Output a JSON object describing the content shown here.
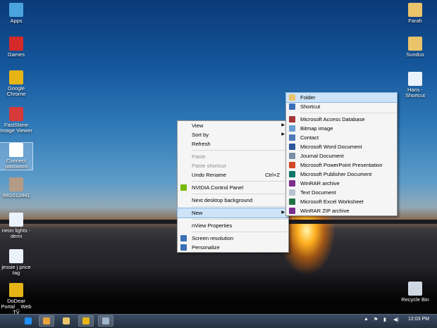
{
  "desktop_icons": [
    {
      "label": "Apps",
      "icon": "monitor-icon",
      "color": "#4aa3df"
    },
    {
      "label": "Games",
      "icon": "games-icon",
      "color": "#d42a2a"
    },
    {
      "label": "Google Chrome",
      "icon": "chrome-icon",
      "color": "#e7b416"
    },
    {
      "label": "FastStone Image Viewer",
      "icon": "faststone-icon",
      "color": "#d73a3a"
    },
    {
      "label": "Connect password",
      "icon": "document-icon",
      "color": "#ffffff"
    },
    {
      "label": "IMG013441",
      "icon": "image-icon",
      "color": "#b49b86"
    },
    {
      "label": "neon lights - demi",
      "icon": "audio-file-icon",
      "color": "#eaf2fb"
    },
    {
      "label": "jessie j price tag",
      "icon": "audio-file-icon",
      "color": "#eaf2fb"
    },
    {
      "label": "DoDear Portal _ Web TV",
      "icon": "chrome-icon",
      "color": "#e7b416"
    }
  ],
  "desktop_icons_right": [
    {
      "label": "Farah",
      "icon": "folder-icon",
      "color": "#e9c46a"
    },
    {
      "label": "Sundus",
      "icon": "folder-icon",
      "color": "#e9c46a"
    },
    {
      "label": "Hans - Shortcut",
      "icon": "shortcut-icon",
      "color": "#eaf2fb"
    },
    {
      "label": "Recycle Bin",
      "icon": "recycle-bin-icon",
      "color": "#cfd8e2"
    }
  ],
  "context_menu": [
    {
      "label": "View",
      "submenu": true
    },
    {
      "label": "Sort by",
      "submenu": true
    },
    {
      "label": "Refresh"
    },
    {
      "sep": true
    },
    {
      "label": "Paste",
      "disabled": true
    },
    {
      "label": "Paste shortcut",
      "disabled": true
    },
    {
      "label": "Undo Rename",
      "shortcut": "Ctrl+Z"
    },
    {
      "sep": true
    },
    {
      "label": "NVIDIA Control Panel",
      "icon": "nvidia-icon",
      "color": "#76b900"
    },
    {
      "sep": true
    },
    {
      "label": "Next desktop background"
    },
    {
      "sep": true
    },
    {
      "label": "New",
      "submenu": true,
      "highlighted": true
    },
    {
      "sep": true
    },
    {
      "label": "nView Properties"
    },
    {
      "sep": true
    },
    {
      "label": "Screen resolution",
      "icon": "screen-resolution-icon",
      "color": "#3b6fb6"
    },
    {
      "label": "Personalize",
      "icon": "personalize-icon",
      "color": "#3b6fb6"
    }
  ],
  "new_submenu": [
    {
      "label": "Folder",
      "icon": "folder-icon",
      "color": "#e9c46a",
      "highlighted": true
    },
    {
      "label": "Shortcut",
      "icon": "shortcut-icon",
      "color": "#3b6fb6"
    },
    {
      "sep": true
    },
    {
      "label": "Microsoft Access Database",
      "icon": "access-icon",
      "color": "#a4373a"
    },
    {
      "label": "Bitmap image",
      "icon": "bitmap-icon",
      "color": "#6a9fd4"
    },
    {
      "label": "Contact",
      "icon": "contact-icon",
      "color": "#4f7ab8"
    },
    {
      "label": "Microsoft Word Document",
      "icon": "word-icon",
      "color": "#2b579a"
    },
    {
      "label": "Journal Document",
      "icon": "journal-icon",
      "color": "#7a8fa6"
    },
    {
      "label": "Microsoft PowerPoint Presentation",
      "icon": "powerpoint-icon",
      "color": "#d24726"
    },
    {
      "label": "Microsoft Publisher Document",
      "icon": "publisher-icon",
      "color": "#077568"
    },
    {
      "label": "WinRAR archive",
      "icon": "winrar-icon",
      "color": "#7b2e8e"
    },
    {
      "label": "Text Document",
      "icon": "text-document-icon",
      "color": "#b8c3cf"
    },
    {
      "label": "Microsoft Excel Worksheet",
      "icon": "excel-icon",
      "color": "#217346"
    },
    {
      "label": "WinRAR ZIP archive",
      "icon": "winrar-zip-icon",
      "color": "#7b2e8e"
    }
  ],
  "taskbar": {
    "items": [
      {
        "icon": "ie-icon",
        "color": "#1e90ff"
      },
      {
        "icon": "media-player-icon",
        "color": "#e8a33c",
        "active": true
      },
      {
        "icon": "file-explorer-icon",
        "color": "#e9c46a"
      },
      {
        "icon": "chrome-icon",
        "color": "#e7b416",
        "active": true
      },
      {
        "icon": "faststone-icon",
        "color": "#9fb6cc",
        "active": true
      }
    ],
    "clock": "12:03 PM",
    "tray_icons": [
      "chevron-up-icon",
      "flag-icon",
      "network-icon",
      "volume-icon"
    ]
  }
}
